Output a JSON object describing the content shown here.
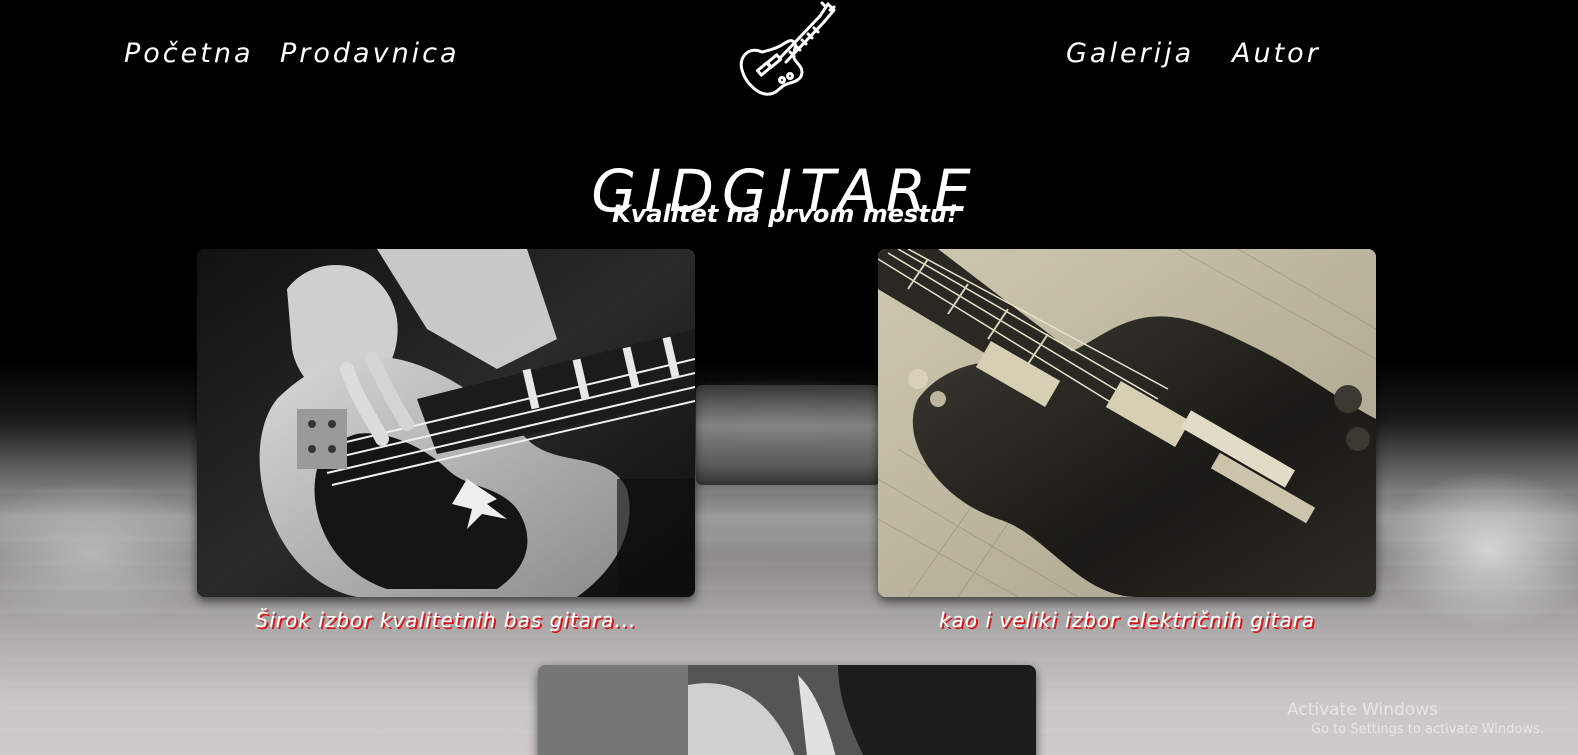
{
  "nav": {
    "home": "Početna",
    "shop": "Prodavnica",
    "gallery": "Galerija",
    "author": "Autor"
  },
  "header": {
    "logo_icon": "electric-guitar-icon",
    "title": "GIDGITARE",
    "tagline": "Kvalitet na prvom mestu!"
  },
  "gallery": {
    "cards": [
      {
        "image": "bass-guitar-photo",
        "caption": "Širok izbor kvalitetnih bas gitara..."
      },
      {
        "image": "electric-guitar-photo",
        "caption": "kao i veliki izbor električnih gitara"
      },
      {
        "image": "guitar-player-photo",
        "caption": ""
      }
    ]
  },
  "os_watermark": {
    "title": "Activate Windows",
    "subtitle": "Go to Settings to activate Windows."
  },
  "colors": {
    "background": "#000000",
    "text": "#ffffff",
    "caption_shadow": "#dd1111"
  }
}
